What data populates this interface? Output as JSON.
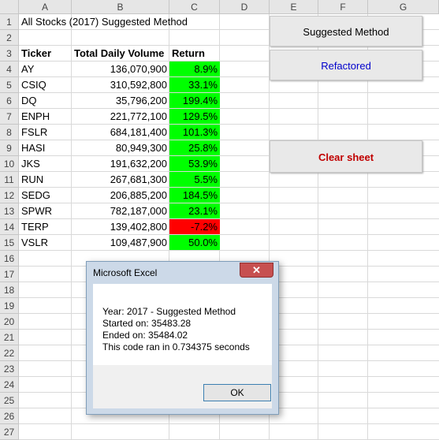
{
  "columns": [
    "A",
    "B",
    "C",
    "D",
    "E",
    "F",
    "G"
  ],
  "rows": [
    "1",
    "2",
    "3",
    "4",
    "5",
    "6",
    "7",
    "8",
    "9",
    "10",
    "11",
    "12",
    "13",
    "14",
    "15",
    "16",
    "17",
    "18",
    "19",
    "20",
    "21",
    "22",
    "23",
    "24",
    "25",
    "26",
    "27"
  ],
  "sheet_title": "All Stocks (2017) Suggested Method",
  "table": {
    "headers": [
      "Ticker",
      "Total Daily Volume",
      "Return"
    ],
    "rows": [
      {
        "ticker": "AY",
        "volume": "136,070,900",
        "return": "8.9%",
        "status": "positive"
      },
      {
        "ticker": "CSIQ",
        "volume": "310,592,800",
        "return": "33.1%",
        "status": "positive"
      },
      {
        "ticker": "DQ",
        "volume": "35,796,200",
        "return": "199.4%",
        "status": "positive"
      },
      {
        "ticker": "ENPH",
        "volume": "221,772,100",
        "return": "129.5%",
        "status": "positive"
      },
      {
        "ticker": "FSLR",
        "volume": "684,181,400",
        "return": "101.3%",
        "status": "positive"
      },
      {
        "ticker": "HASI",
        "volume": "80,949,300",
        "return": "25.8%",
        "status": "positive"
      },
      {
        "ticker": "JKS",
        "volume": "191,632,200",
        "return": "53.9%",
        "status": "positive"
      },
      {
        "ticker": "RUN",
        "volume": "267,681,300",
        "return": "5.5%",
        "status": "positive"
      },
      {
        "ticker": "SEDG",
        "volume": "206,885,200",
        "return": "184.5%",
        "status": "positive"
      },
      {
        "ticker": "SPWR",
        "volume": "782,187,000",
        "return": "23.1%",
        "status": "positive"
      },
      {
        "ticker": "TERP",
        "volume": "139,402,800",
        "return": "-7.2%",
        "status": "negative"
      },
      {
        "ticker": "VSLR",
        "volume": "109,487,900",
        "return": "50.0%",
        "status": "positive"
      }
    ]
  },
  "buttons": {
    "suggested": {
      "label": "Suggested Method",
      "color": "#000000"
    },
    "refactored": {
      "label": "Refactored",
      "color": "#0000cc"
    },
    "clear": {
      "label": "Clear sheet",
      "color": "#c00000"
    }
  },
  "dialog": {
    "title": "Microsoft Excel",
    "close": "✕",
    "lines": [
      "Year: 2017 - Suggested Method",
      "Started on: 35483.28",
      "Ended on: 35484.02",
      "This code ran in 0.734375 seconds"
    ],
    "ok_label": "OK"
  },
  "colors": {
    "positive": "#00ff00",
    "negative": "#ff0000"
  }
}
